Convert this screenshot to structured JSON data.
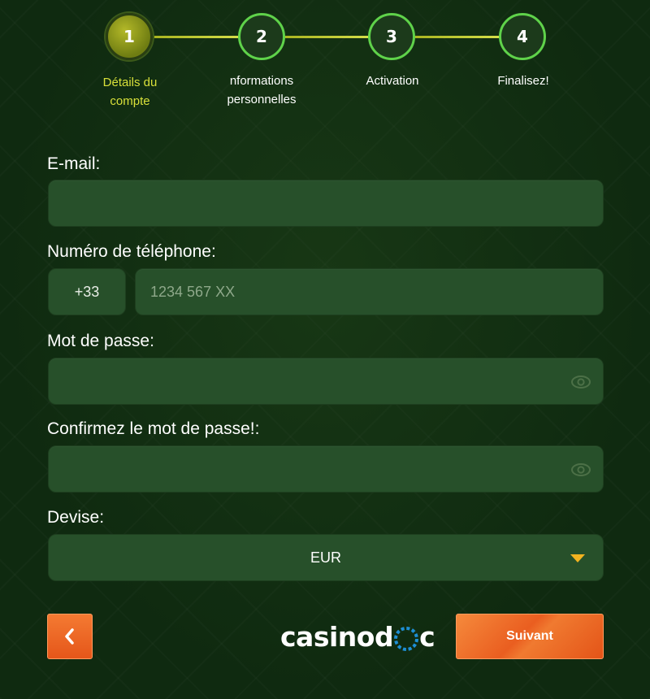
{
  "stepper": {
    "steps": [
      {
        "number": "1",
        "label_line1": "Détails du",
        "label_line2": "compte",
        "active": true
      },
      {
        "number": "2",
        "label_line1": "nformations",
        "label_line2": "personnelles",
        "active": false
      },
      {
        "number": "3",
        "label_line1": "Activation",
        "label_line2": "",
        "active": false
      },
      {
        "number": "4",
        "label_line1": "Finalisez!",
        "label_line2": "",
        "active": false
      }
    ]
  },
  "form": {
    "email_label": "E-mail:",
    "email_value": "",
    "phone_label": "Numéro de téléphone:",
    "phone_prefix": "+33",
    "phone_placeholder": "1234 567 XX",
    "password_label": "Mot de passe:",
    "password_value": "",
    "confirm_label": "Confirmez le mot de passe!:",
    "confirm_value": "",
    "currency_label": "Devise:",
    "currency_selected": "EUR"
  },
  "footer": {
    "next_label": "Suivant",
    "logo_left": "casino",
    "logo_right": "c"
  },
  "colors": {
    "accent_orange": "#ea5e20",
    "step_active": "#d8e03a",
    "field_bg": "#27502a",
    "step_ring": "#5fd24a",
    "chevron": "#f2b320"
  },
  "icons": {
    "back": "chevron-left-icon",
    "password_toggle": "eye-icon",
    "select": "chevron-down-icon",
    "logo_wheel": "roulette-wheel-icon"
  }
}
